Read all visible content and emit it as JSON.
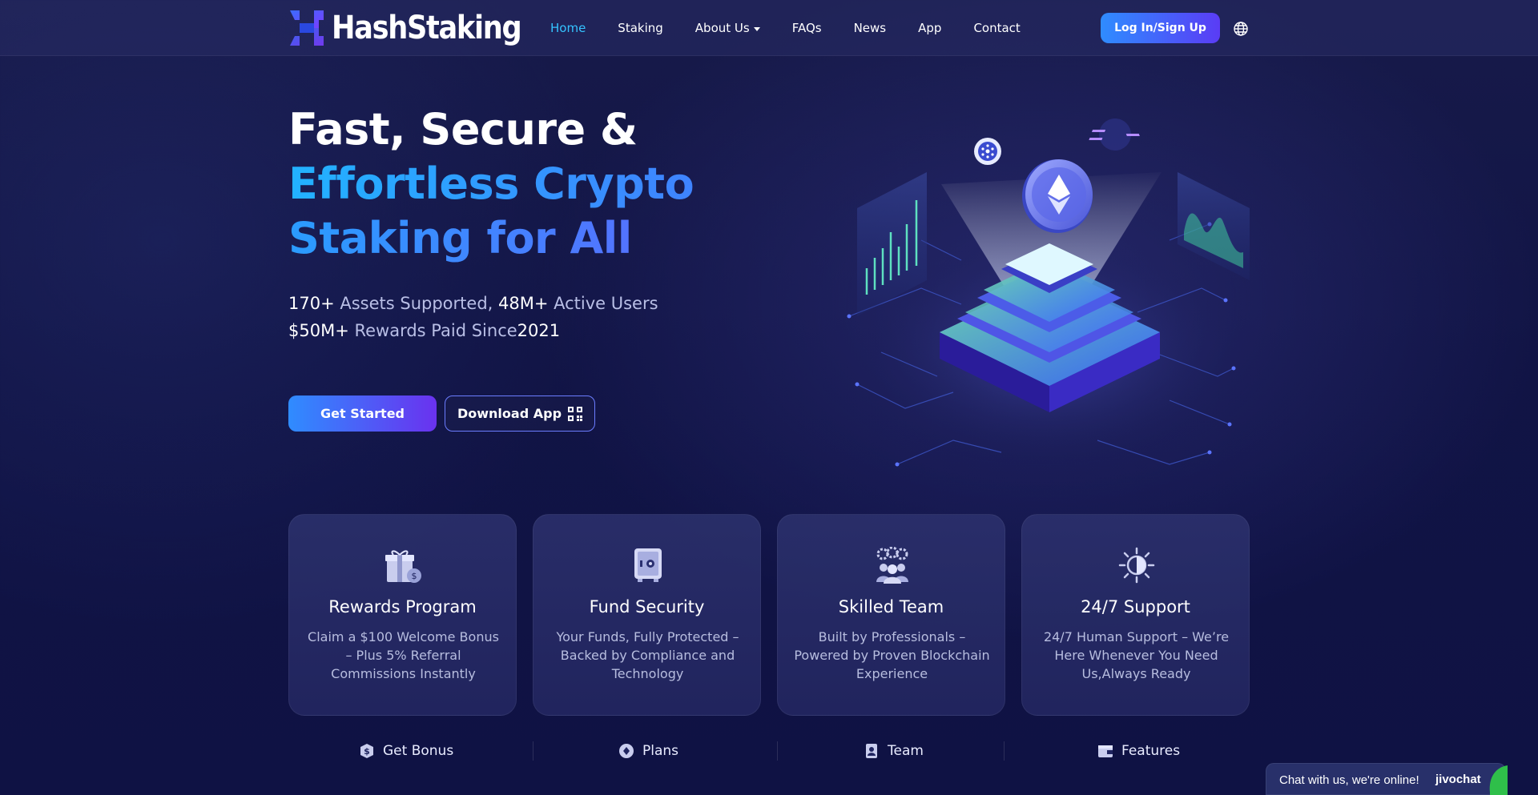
{
  "brand": {
    "name": "HashStaking"
  },
  "nav": {
    "items": [
      {
        "label": "Home",
        "active": true
      },
      {
        "label": "Staking"
      },
      {
        "label": "About Us",
        "dropdown": true
      },
      {
        "label": "FAQs"
      },
      {
        "label": "News"
      },
      {
        "label": "App"
      },
      {
        "label": "Contact"
      }
    ],
    "login_label": "Log In/Sign Up",
    "language_icon": "globe-icon"
  },
  "hero": {
    "title_line1": "Fast, Secure &",
    "title_line2": "Effortless Crypto",
    "title_line3": "Staking for All",
    "stats": {
      "assets_value": "170+",
      "assets_text": " Assets Supported, ",
      "users_value": "48M+",
      "users_text": " Active Users",
      "rewards_value": "$50M+",
      "rewards_text": " Rewards Paid Since",
      "year": "2021"
    },
    "cta_primary": "Get Started",
    "cta_secondary": "Download App"
  },
  "features": [
    {
      "icon": "gift-icon",
      "title": "Rewards Program",
      "description": "Claim a $100 Welcome Bonus – Plus 5% Referral Commissions Instantly"
    },
    {
      "icon": "safe-icon",
      "title": "Fund Security",
      "description": "Your Funds, Fully Protected – Backed by Compliance and Technology"
    },
    {
      "icon": "team-icon",
      "title": "Skilled Team",
      "description": "Built by Professionals – Powered by Proven Blockchain Experience"
    },
    {
      "icon": "support-icon",
      "title": "24/7 Support",
      "description": "24/7 Human Support – We’re Here Whenever You Need Us,Always Ready"
    }
  ],
  "quick_links": [
    {
      "icon": "dollar-shield-icon",
      "label": "Get Bonus"
    },
    {
      "icon": "plans-icon",
      "label": "Plans"
    },
    {
      "icon": "team-badge-icon",
      "label": "Team"
    },
    {
      "icon": "wallet-icon",
      "label": "Features"
    }
  ],
  "chat": {
    "text": "Chat with us, we're online!",
    "brand": "jivochat"
  },
  "colors": {
    "accent": "#35c3ff",
    "button_start": "#2f8cff",
    "button_end": "#6a32ef",
    "background": "#111445"
  }
}
